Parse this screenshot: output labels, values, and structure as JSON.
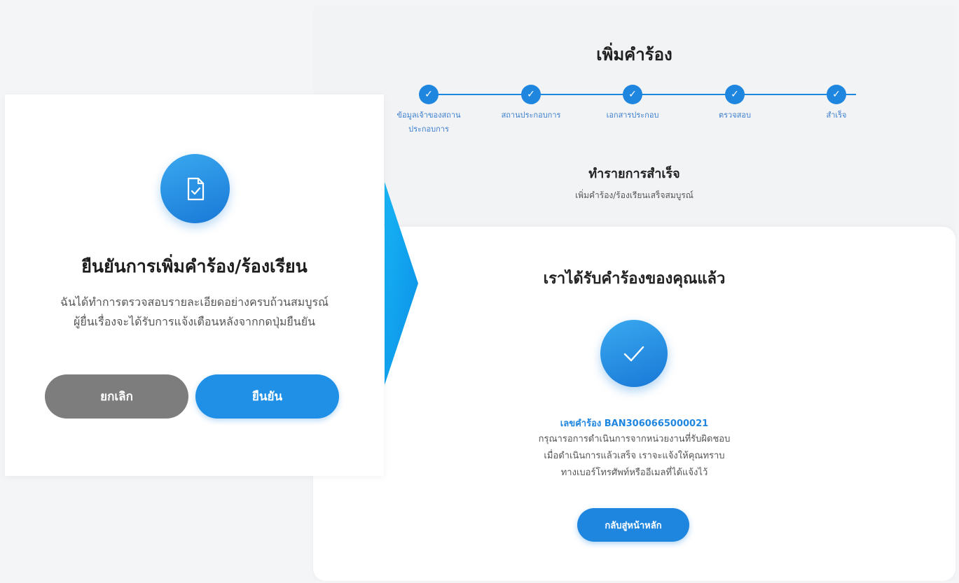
{
  "success_page": {
    "title": "เพิ่มคำร้อง",
    "steps": [
      {
        "label": "ข้อมูลเจ้าของสถานประกอบการ"
      },
      {
        "label": "สถานประกอบการ"
      },
      {
        "label": "เอกสารประกอบ"
      },
      {
        "label": "ตรวจสอบ"
      },
      {
        "label": "สำเร็จ"
      }
    ],
    "status_title": "ทำรายการสำเร็จ",
    "status_desc": "เพิ่มคำร้อง/ร้องเรียนเสร็จสมบูรณ์",
    "card": {
      "title": "เราได้รับคำร้องของคุณแล้ว",
      "ref_number": "เลขคำร้อง BAN3060665000021",
      "desc_line1": "กรุณารอการดำเนินการจากหน่วยงานที่รับผิดชอบ",
      "desc_line2": "เมื่อดำเนินการแล้วเสร็จ เราจะแจ้งให้คุณทราบ",
      "desc_line3": "ทางเบอร์โทรศัพท์หรืออีเมลที่ได้แจ้งไว้",
      "home_button": "กลับสู่หน้าหลัก"
    }
  },
  "confirm_modal": {
    "title": "ยืนยันการเพิ่มคำร้อง/ร้องเรียน",
    "desc_line1": "ฉันได้ทำการตรวจสอบรายละเอียดอย่างครบถ้วนสมบูรณ์",
    "desc_line2": "ผู้ยื่นเรื่องจะได้รับการแจ้งเตือนหลังจากกดปุ่มยืนยัน",
    "cancel_label": "ยกเลิก",
    "confirm_label": "ยืนยัน"
  },
  "icons": {
    "step": "check-icon",
    "modal": "document-check-icon",
    "success": "check-icon",
    "transition": "arrow-right-icon"
  },
  "colors": {
    "primary": "#1f86e0",
    "cancel": "#7d7d7d",
    "arrow": "#0aa2f0"
  }
}
